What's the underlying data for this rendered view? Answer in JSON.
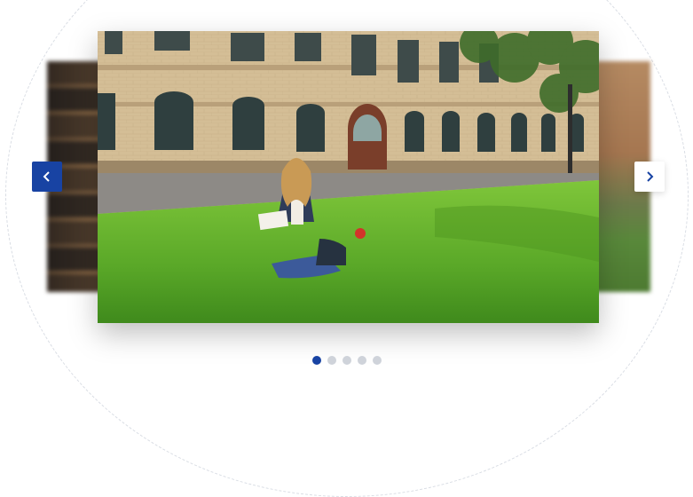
{
  "carousel": {
    "slides": [
      {
        "image": "photo-student-reading-on-campus-lawn",
        "state": "active"
      },
      {
        "image": "photo-blurred-bookshelf",
        "state": "previous"
      },
      {
        "image": "photo-blurred-building-and-lawn",
        "state": "next"
      },
      {
        "image": "slide-4",
        "state": "hidden"
      },
      {
        "image": "slide-5",
        "state": "hidden"
      }
    ],
    "active_index": 0,
    "slide_count": 5,
    "prev_icon": "chevron-left-icon",
    "next_icon": "chevron-right-icon"
  },
  "colors": {
    "accent": "#1843a3",
    "dot_inactive": "#cfd3da",
    "next_button_bg": "#ffffff"
  }
}
